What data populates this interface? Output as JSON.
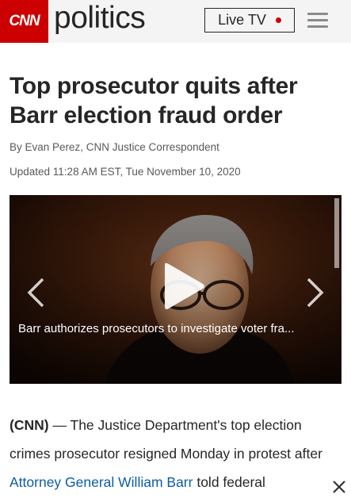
{
  "header": {
    "logo_text": "CNN",
    "section": "politics",
    "live_tv_label": "Live TV"
  },
  "article": {
    "headline": "Top prosecutor quits after Barr election fraud order",
    "byline": "By Evan Perez, CNN Justice Correspondent",
    "updated": "Updated 11:28 AM EST, Tue November 10, 2020",
    "video": {
      "caption": "Barr authorizes prosecutors to investigate voter fra..."
    },
    "body": {
      "lead": "(CNN)",
      "dash": " — ",
      "text_1": "The Justice Department's top election crimes prosecutor resigned Monday in protest after ",
      "link": "Attorney General William Barr",
      "text_2": " told federal"
    }
  },
  "colors": {
    "brand_red": "#cc0000",
    "link_blue": "#0c5da5",
    "text": "#262626",
    "meta_text": "#595959"
  },
  "icons": [
    "menu-icon",
    "play-icon",
    "chevron-left-icon",
    "chevron-right-icon",
    "close-icon",
    "live-dot-icon"
  ]
}
